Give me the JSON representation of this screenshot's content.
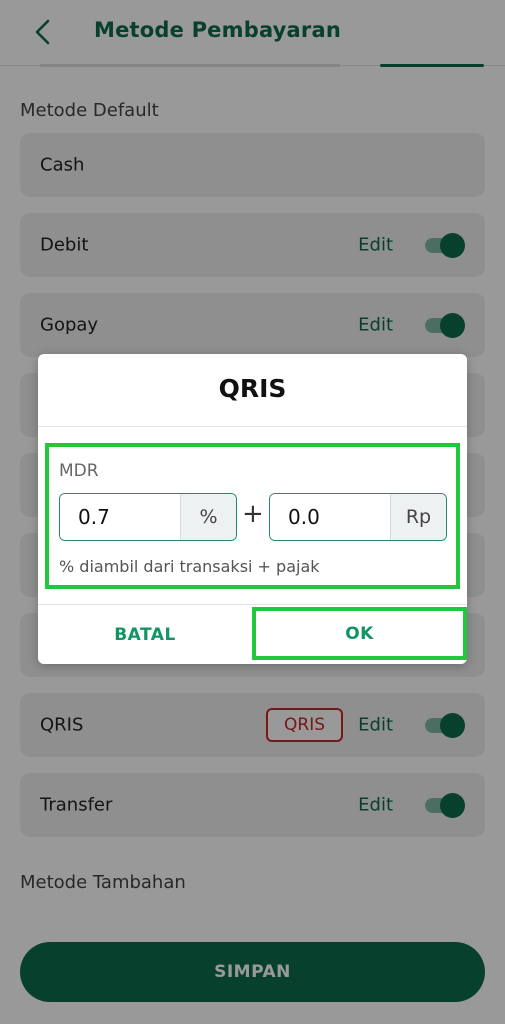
{
  "header": {
    "title": "Metode Pembayaran"
  },
  "sections": {
    "default_label": "Metode Default",
    "extra_label": "Metode Tambahan"
  },
  "methods": [
    {
      "name": "Cash",
      "edit": "",
      "enabled": null
    },
    {
      "name": "Debit",
      "edit": "Edit",
      "enabled": true
    },
    {
      "name": "Gopay",
      "edit": "Edit",
      "enabled": true
    },
    {
      "name": "QRIS",
      "edit": "Edit",
      "enabled": true,
      "badge": "QRIS"
    },
    {
      "name": "Transfer",
      "edit": "Edit",
      "enabled": true
    }
  ],
  "save_button": "SIMPAN",
  "dialog": {
    "title": "QRIS",
    "mdr_label": "MDR",
    "percent_value": "0.7",
    "percent_suffix": "%",
    "plus": "+",
    "rp_value": "0.0",
    "rp_suffix": "Rp",
    "help_text": "% diambil dari transaksi + pajak",
    "cancel_label": "BATAL",
    "ok_label": "OK"
  },
  "colors": {
    "brand": "#0c6b4b",
    "accent_text": "#139463",
    "badge_red": "#c62828",
    "highlight_green": "#22c83c"
  }
}
